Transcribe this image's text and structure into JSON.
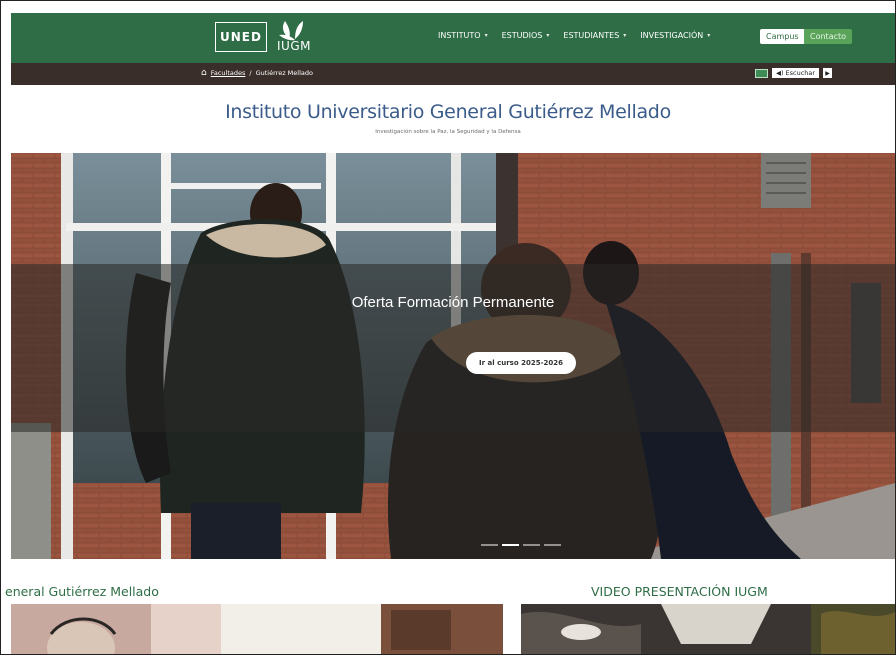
{
  "header": {
    "logo_uned": "UNED",
    "logo_iugm": "IUGM",
    "nav": [
      {
        "label": "INSTITUTO"
      },
      {
        "label": "ESTUDIOS"
      },
      {
        "label": "ESTUDIANTES"
      },
      {
        "label": "INVESTIGACIÓN"
      }
    ],
    "campus_label": "Campus",
    "contacto_label": "Contacto"
  },
  "breadcrumb": {
    "items": [
      "Facultades",
      "Gutiérrez Mellado"
    ],
    "separator": "/",
    "listen_label": "Escuchar"
  },
  "page": {
    "title": "Instituto Universitario General Gutiérrez Mellado",
    "subtitle": "Investigación sobre la Paz, la Seguridad y la Defensa"
  },
  "hero": {
    "title": "Oferta Formación Permanente",
    "button_label": "Ir al curso 2025-2026",
    "slides_count": 4,
    "active_slide": 2
  },
  "sections": {
    "left_heading": "eneral Gutiérrez Mellado",
    "right_heading": "VIDEO PRESENTACIÓN IUGM"
  },
  "colors": {
    "nav_green": "#2e6d45",
    "breadcrumb_bg": "#3a2e2a",
    "title_blue": "#3b5c8a",
    "contact_green": "#5aa35a"
  }
}
